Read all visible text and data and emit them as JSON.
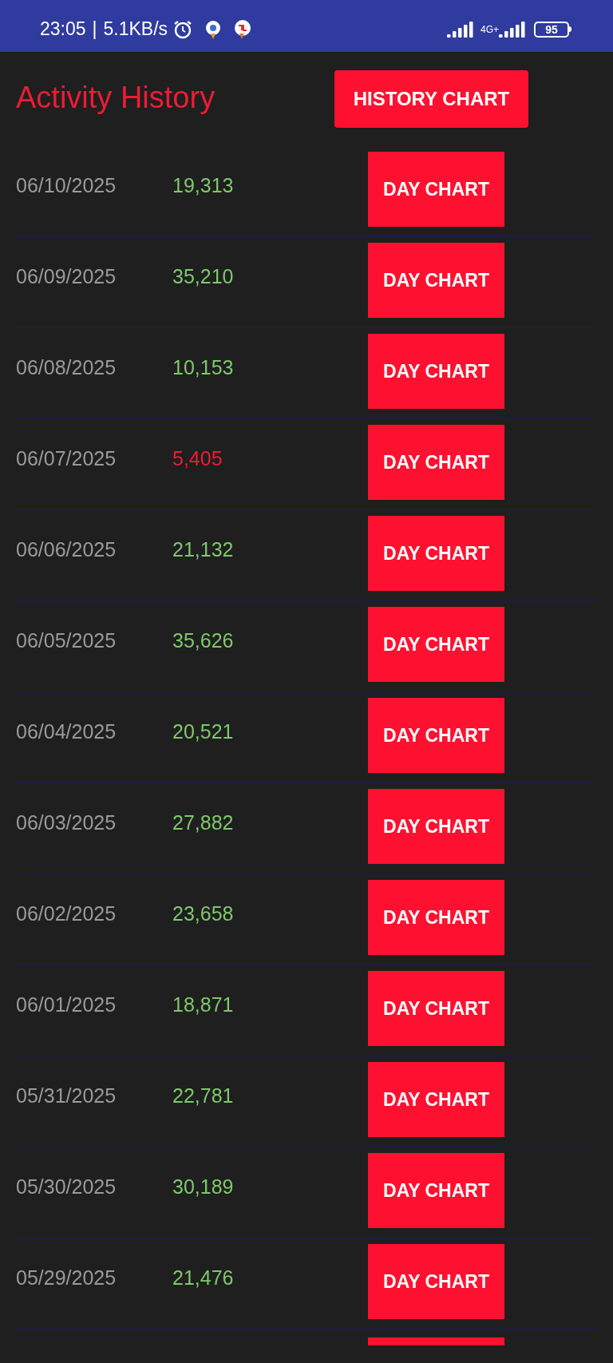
{
  "status_bar": {
    "time": "23:05",
    "separator": "|",
    "speed": "5.1KB/s",
    "network": "4G+",
    "battery": "95"
  },
  "header": {
    "title": "Activity History",
    "button": "HISTORY CHART"
  },
  "rows": [
    {
      "date": "06/10/2025",
      "steps": "19,313",
      "color": "#7dc96b",
      "button": "DAY CHART"
    },
    {
      "date": "06/09/2025",
      "steps": "35,210",
      "color": "#7dc96b",
      "button": "DAY CHART"
    },
    {
      "date": "06/08/2025",
      "steps": "10,153",
      "color": "#7dc96b",
      "button": "DAY CHART"
    },
    {
      "date": "06/07/2025",
      "steps": "5,405",
      "color": "#ec1c35",
      "button": "DAY CHART"
    },
    {
      "date": "06/06/2025",
      "steps": "21,132",
      "color": "#7dc96b",
      "button": "DAY CHART"
    },
    {
      "date": "06/05/2025",
      "steps": "35,626",
      "color": "#7dc96b",
      "button": "DAY CHART"
    },
    {
      "date": "06/04/2025",
      "steps": "20,521",
      "color": "#7dc96b",
      "button": "DAY CHART"
    },
    {
      "date": "06/03/2025",
      "steps": "27,882",
      "color": "#7dc96b",
      "button": "DAY CHART"
    },
    {
      "date": "06/02/2025",
      "steps": "23,658",
      "color": "#7dc96b",
      "button": "DAY CHART"
    },
    {
      "date": "06/01/2025",
      "steps": "18,871",
      "color": "#7dc96b",
      "button": "DAY CHART"
    },
    {
      "date": "05/31/2025",
      "steps": "22,781",
      "color": "#7dc96b",
      "button": "DAY CHART"
    },
    {
      "date": "05/30/2025",
      "steps": "30,189",
      "color": "#7dc96b",
      "button": "DAY CHART"
    },
    {
      "date": "05/29/2025",
      "steps": "21,476",
      "color": "#7dc96b",
      "button": "DAY CHART"
    }
  ]
}
